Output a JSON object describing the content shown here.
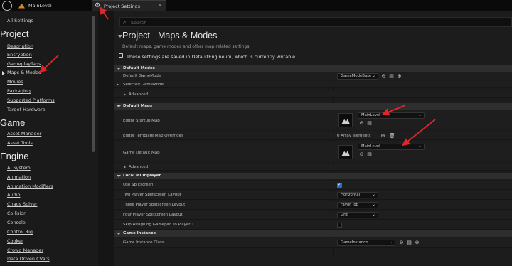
{
  "tabs": {
    "main_level": "MainLevel",
    "project_settings": "Project Settings",
    "close_glyph": "✕"
  },
  "sidebar": {
    "all_settings": "All Settings",
    "project_heading": "Project",
    "project_items": [
      "Description",
      "Encryption",
      "GameplayTags",
      "Maps & Modes",
      "Movies",
      "Packaging",
      "Supported Platforms",
      "Target Hardware"
    ],
    "game_heading": "Game",
    "game_items": [
      "Asset Manager",
      "Asset Tools"
    ],
    "engine_heading": "Engine",
    "engine_items": [
      "AI System",
      "Animation",
      "Animation Modifiers",
      "Audio",
      "Chaos Solver",
      "Collision",
      "Console",
      "Control Rig",
      "Cooker",
      "Crowd Manager",
      "Data Driven CVars"
    ],
    "selected": "Maps & Modes"
  },
  "main": {
    "search_placeholder": "Search",
    "title": "Project - Maps & Modes",
    "subtitle": "Default maps, game modes and other map related settings.",
    "notice": "These settings are saved in DefaultEngine.ini, which is currently writable."
  },
  "sections": {
    "default_modes": {
      "label": "Default Modes",
      "default_gamemode_label": "Default GameMode",
      "default_gamemode_value": "GameModeBase",
      "selected_gamemode_label": "Selected GameMode",
      "advanced_label": "Advanced"
    },
    "default_maps": {
      "label": "Default Maps",
      "editor_startup_label": "Editor Startup Map",
      "editor_startup_value": "MainLevel",
      "editor_template_label": "Editor Template Map Overrides",
      "editor_template_value": "0 Array elements",
      "game_default_label": "Game Default Map",
      "game_default_value": "MainLevel",
      "advanced_label": "Advanced"
    },
    "local_multiplayer": {
      "label": "Local Multiplayer",
      "use_splitscreen_label": "Use Splitscreen",
      "use_splitscreen_checked": true,
      "two_player_label": "Two Player Splitscreen Layout",
      "two_player_value": "Horizontal",
      "three_player_label": "Three Player Splitscreen Layout",
      "three_player_value": "Favor Top",
      "four_player_label": "Four Player Splitscreen Layout",
      "four_player_value": "Grid",
      "skip_gamepad_label": "Skip Assigning Gamepad to Player 1",
      "skip_gamepad_checked": false
    },
    "game_instance": {
      "label": "Game Instance",
      "class_label": "Game Instance Class",
      "class_value": "GameInstance"
    }
  },
  "colors": {
    "accent_blue": "#1e6fd9",
    "annotation_red": "#e0262b",
    "level_icon_orange": "#d08a1e"
  },
  "icons": [
    "unreal-logo-icon",
    "level-icon",
    "gear-icon",
    "close-icon",
    "search-icon",
    "lock-icon",
    "browse-icon",
    "folder-icon",
    "add-icon",
    "trash-icon",
    "chevron-down-icon"
  ]
}
